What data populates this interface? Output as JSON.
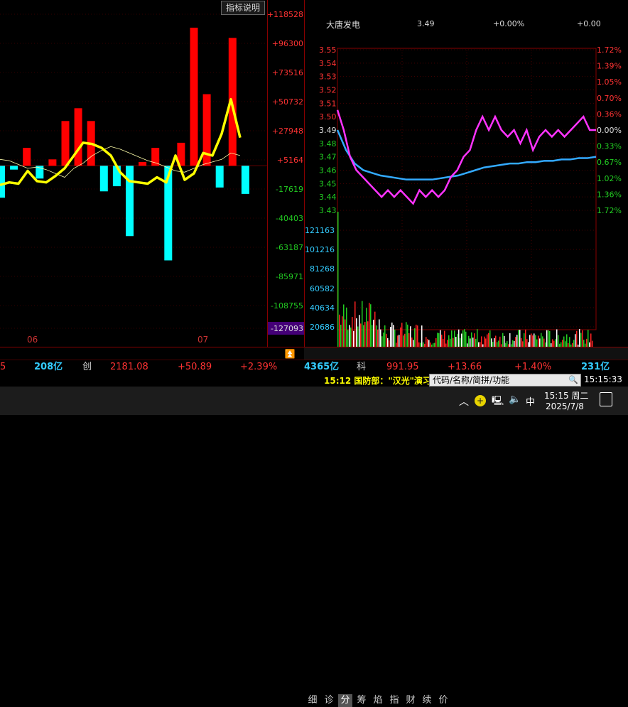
{
  "left_panel": {
    "indicator_button": "指标说明",
    "axis_labels": [
      "+118528",
      "+96300",
      "+73516",
      "+50732",
      "+27948",
      "+5164",
      "-17619",
      "-40403",
      "-63187",
      "-85971",
      "-108755",
      "-127093"
    ],
    "date_labels": [
      "06",
      "07"
    ],
    "bars": [
      {
        "v": -25000
      },
      {
        "v": -3000
      },
      {
        "v": 14000
      },
      {
        "v": -10000
      },
      {
        "v": 5000
      },
      {
        "v": 35000
      },
      {
        "v": 45000
      },
      {
        "v": 35000
      },
      {
        "v": -20000
      },
      {
        "v": -16000
      },
      {
        "v": -55000
      },
      {
        "v": 3000
      },
      {
        "v": 14000
      },
      {
        "v": -74000
      },
      {
        "v": 18000
      },
      {
        "v": 108000
      },
      {
        "v": 56000
      },
      {
        "v": -17000
      },
      {
        "v": 100000
      },
      {
        "v": -22000
      }
    ],
    "ma_line": [
      -15000,
      -13000,
      -14000,
      -4000,
      -12000,
      -13000,
      -8000,
      -2000,
      8000,
      18000,
      17000,
      14000,
      8000,
      -5000,
      -12000,
      -13000,
      -14000,
      -9000,
      -13000,
      8000,
      -11000,
      -6000,
      10000,
      8000,
      25000,
      52000,
      22000
    ],
    "thin_line": [
      5000,
      4000,
      1000,
      -2000,
      -1000,
      -3000,
      -6000,
      -9000,
      -2000,
      2000,
      8000,
      12000,
      15000,
      13000,
      10000,
      7000,
      4000,
      2000,
      -1000,
      -4000,
      -5000,
      -2000,
      1000,
      3000,
      5000,
      10000,
      8000
    ]
  },
  "quote": {
    "stock_name": "大唐发电",
    "price": "3.49",
    "change_pct": "+0.00%",
    "change": "+0.00",
    "price_labels": [
      "3.55",
      "3.54",
      "3.53",
      "3.52",
      "3.51",
      "3.50",
      "3.49",
      "3.48",
      "3.47",
      "3.46",
      "3.45",
      "3.44",
      "3.43"
    ],
    "pct_labels": [
      "1.72%",
      "1.39%",
      "1.05%",
      "0.70%",
      "0.36%",
      "0.00%",
      "0.33%",
      "0.67%",
      "1.02%",
      "1.36%",
      "1.72%"
    ],
    "volume_labels": [
      "121163",
      "101216",
      "81268",
      "60582",
      "40634",
      "20686"
    ],
    "price_line": [
      3.505,
      3.49,
      3.47,
      3.46,
      3.455,
      3.45,
      3.445,
      3.44,
      3.445,
      3.44,
      3.445,
      3.44,
      3.435,
      3.445,
      3.44,
      3.445,
      3.44,
      3.445,
      3.455,
      3.46,
      3.47,
      3.475,
      3.49,
      3.5,
      3.49,
      3.5,
      3.49,
      3.485,
      3.49,
      3.48,
      3.49,
      3.475,
      3.485,
      3.49,
      3.485,
      3.49,
      3.485,
      3.49,
      3.495,
      3.5,
      3.49,
      3.49
    ],
    "avg_line": [
      3.49,
      3.475,
      3.465,
      3.46,
      3.458,
      3.456,
      3.455,
      3.454,
      3.453,
      3.453,
      3.453,
      3.453,
      3.454,
      3.455,
      3.456,
      3.458,
      3.46,
      3.462,
      3.463,
      3.464,
      3.465,
      3.465,
      3.466,
      3.466,
      3.467,
      3.467,
      3.468,
      3.468,
      3.469,
      3.469,
      3.47
    ]
  },
  "right_tabs": [
    "细",
    "诊",
    "分",
    "筹",
    "焰",
    "指",
    "财",
    "续",
    "价"
  ],
  "active_tab": "分",
  "ticker": {
    "left_tail": "5",
    "left_amount": "208亿",
    "board": "创",
    "index_value": "2181.08",
    "index_change": "+50.89",
    "index_pct": "+2.39%",
    "amount2": "4365亿",
    "board2": "科",
    "index2_value": "991.95",
    "index2_change": "+13.66",
    "index2_pct": "+1.40%",
    "amount3": "231亿"
  },
  "news": {
    "text": "15:12 国防部：\"汉光\"演习",
    "search_placeholder": "代码/名称/简拼/功能",
    "clock": "15:15:33"
  },
  "taskbar": {
    "ime": "中",
    "time": "15:15 周二",
    "date": "2025/7/8"
  },
  "colors": {
    "up": "#ff0000",
    "down": "#00ffff",
    "yellow": "#ffff00",
    "magenta": "#ff33ff",
    "avg": "#33aaff"
  }
}
